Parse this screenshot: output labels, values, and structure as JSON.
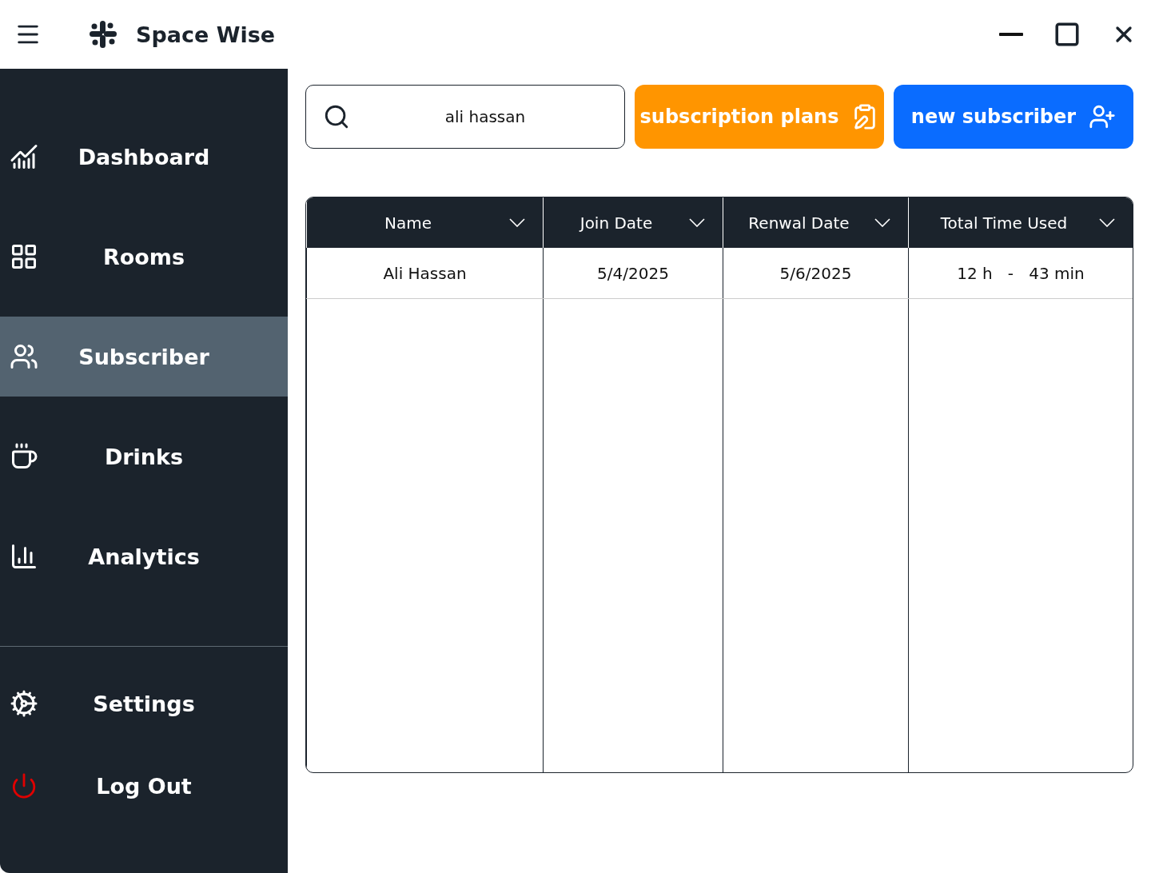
{
  "app": {
    "title": "Space Wise"
  },
  "sidebar": {
    "items": [
      {
        "label": "Dashboard",
        "selected": false
      },
      {
        "label": "Rooms",
        "selected": false
      },
      {
        "label": "Subscriber",
        "selected": true
      },
      {
        "label": "Drinks",
        "selected": false
      },
      {
        "label": "Analytics",
        "selected": false
      }
    ],
    "footer_items": [
      {
        "label": "Settings"
      },
      {
        "label": "Log Out"
      }
    ]
  },
  "search": {
    "value": "ali hassan"
  },
  "buttons": [
    {
      "label": "subscription plans",
      "kind": "plans"
    },
    {
      "label": "new subscriber",
      "kind": "new"
    }
  ],
  "table": {
    "columns": [
      "Name",
      "Join Date",
      "Renwal Date",
      "Total Time Used"
    ],
    "rows": [
      [
        "Ali Hassan",
        "5/4/2025",
        "5/6/2025",
        "12 h   -   43 min"
      ]
    ]
  }
}
